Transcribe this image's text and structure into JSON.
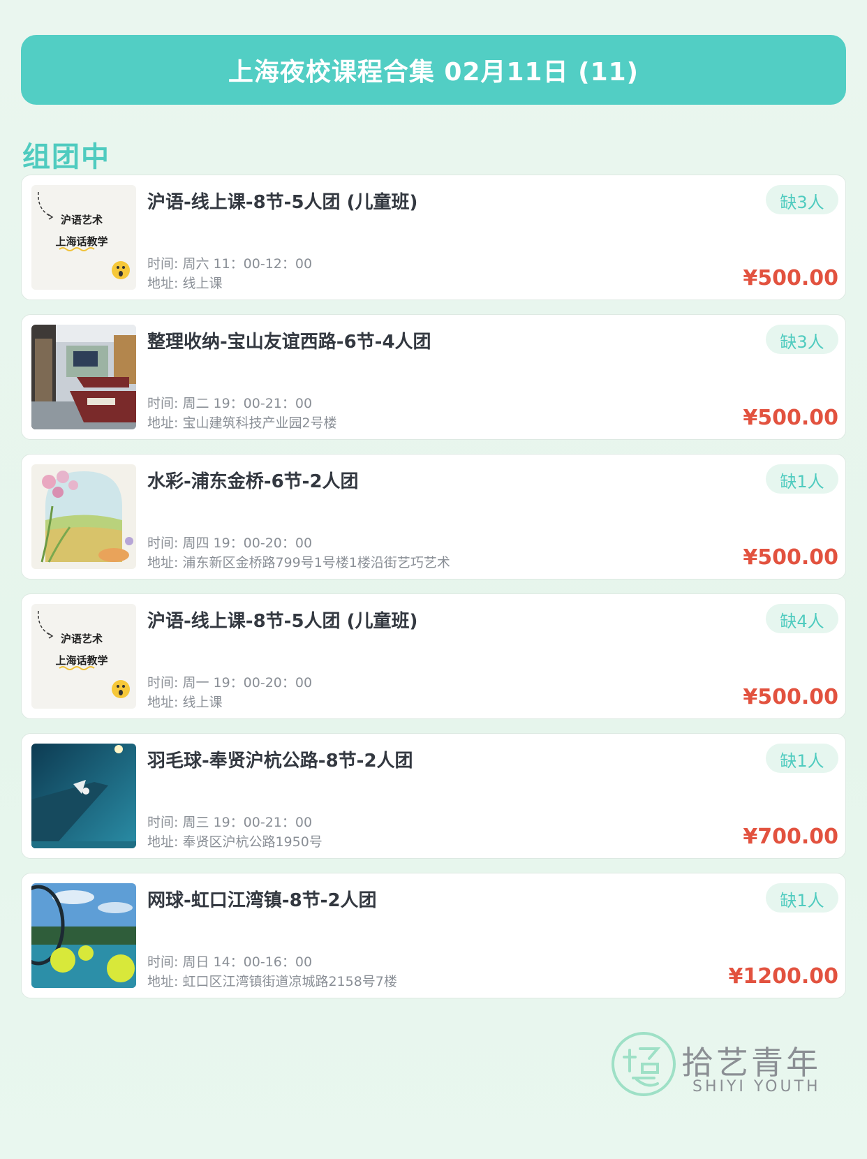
{
  "header": {
    "title": "上海夜校课程合集 02月11日 (11)"
  },
  "section": {
    "title": "组团中"
  },
  "thumb_text": {
    "line1": "沪语艺术",
    "line2": "上海话教学"
  },
  "courses": [
    {
      "title": "沪语-线上课-8节-5人团 (儿童班)",
      "time": "时间: 周六 11：00-12：00",
      "address": "地址: 线上课",
      "badge": "缺3人",
      "price": "¥500.00",
      "thumb": "shanghainese-art-icon"
    },
    {
      "title": "整理收纳-宝山友谊西路-6节-4人团",
      "time": "时间: 周二 19：00-21：00",
      "address": "地址: 宝山建筑科技产业园2号楼",
      "badge": "缺3人",
      "price": "¥500.00",
      "thumb": "classroom-photo"
    },
    {
      "title": "水彩-浦东金桥-6节-2人团",
      "time": "时间: 周四 19：00-20：00",
      "address": "地址: 浦东新区金桥路799号1号楼1楼沿街艺巧艺术",
      "badge": "缺1人",
      "price": "¥500.00",
      "thumb": "watercolor-painting"
    },
    {
      "title": "沪语-线上课-8节-5人团 (儿童班)",
      "time": "时间: 周一 19：00-20：00",
      "address": "地址: 线上课",
      "badge": "缺4人",
      "price": "¥500.00",
      "thumb": "shanghainese-art-icon"
    },
    {
      "title": "羽毛球-奉贤沪杭公路-8节-2人团",
      "time": "时间: 周三 19：00-21：00",
      "address": "地址: 奉贤区沪杭公路1950号",
      "badge": "缺1人",
      "price": "¥700.00",
      "thumb": "badminton-photo"
    },
    {
      "title": "网球-虹口江湾镇-8节-2人团",
      "time": "时间: 周日 14：00-16：00",
      "address": "地址: 虹口区江湾镇街道凉城路2158号7楼",
      "badge": "缺1人",
      "price": "¥1200.00",
      "thumb": "tennis-photo"
    }
  ],
  "logo": {
    "cn": "拾艺青年",
    "en": "SHIYI YOUTH"
  },
  "colors": {
    "accent": "#52cec4",
    "price": "#e2523f",
    "badge_bg": "#e6f6ef"
  }
}
